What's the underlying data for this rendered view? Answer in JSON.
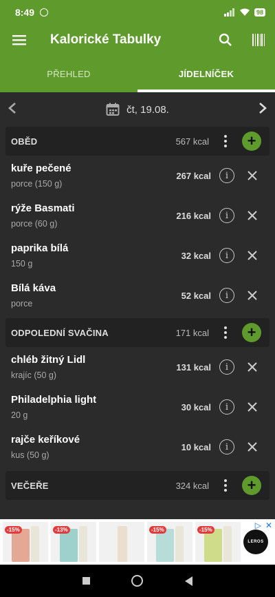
{
  "status": {
    "time": "8:49",
    "battery": "98"
  },
  "app": {
    "title": "Kalorické Tabulky"
  },
  "tabs": [
    {
      "label": "PŘEHLED",
      "active": false
    },
    {
      "label": "JÍDELNÍČEK",
      "active": true
    }
  ],
  "date": {
    "label": "čt, 19.08."
  },
  "sections": [
    {
      "name": "OBĚD",
      "kcal": "567 kcal",
      "items": [
        {
          "name": "kuře pečené",
          "portion": "porce (150 g)",
          "kcal": "267 kcal"
        },
        {
          "name": "rýže Basmati",
          "portion": "porce (60 g)",
          "kcal": "216 kcal"
        },
        {
          "name": "paprika bílá",
          "portion": "150 g",
          "kcal": "32 kcal"
        },
        {
          "name": "Bílá káva",
          "portion": "porce",
          "kcal": "52 kcal"
        }
      ]
    },
    {
      "name": "ODPOLEDNÍ SVAČINA",
      "kcal": "171 kcal",
      "items": [
        {
          "name": "chléb žitný Lidl",
          "portion": "krajíc (50 g)",
          "kcal": "131 kcal"
        },
        {
          "name": "Philadelphia light",
          "portion": "20 g",
          "kcal": "30 kcal"
        },
        {
          "name": "rajče keříkové",
          "portion": "kus (50 g)",
          "kcal": "10 kcal"
        }
      ]
    },
    {
      "name": "VEČEŘE",
      "kcal": "324 kcal",
      "items": []
    }
  ],
  "ad": {
    "badges": [
      "-15%",
      "-13%",
      "",
      "-15%",
      "-15%"
    ],
    "brand": "LEROS"
  },
  "colors": {
    "accent": "#5f9a2c",
    "background": "#2b2b2b",
    "section": "#222222"
  }
}
